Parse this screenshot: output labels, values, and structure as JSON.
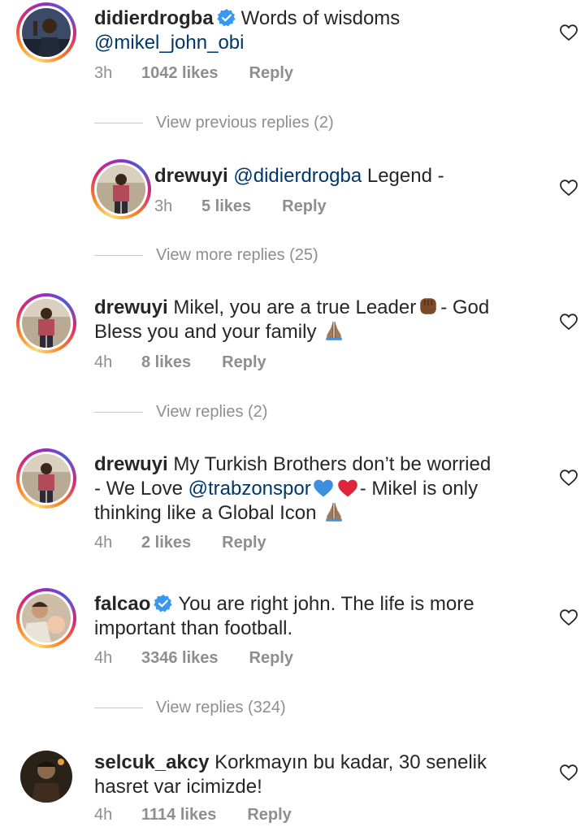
{
  "comments": [
    {
      "username": "didierdrogba",
      "text": "Words of wisdoms",
      "mention": "@mikel_john_obi",
      "time": "3h",
      "likes": "1042 likes",
      "reply": "Reply",
      "verified": true
    },
    {
      "username": "drewuyi",
      "mention": "@didierdrogba",
      "text": "Legend -",
      "time": "3h",
      "likes": "5 likes",
      "reply": "Reply"
    },
    {
      "username": "drewuyi",
      "text_line1": "Mikel, you are a true Leader",
      "text_line1_end": "- God",
      "text_line2": "Bless you and your family",
      "time": "4h",
      "likes": "8 likes",
      "reply": "Reply"
    },
    {
      "username": "drewuyi",
      "text_line1": "My Turkish Brothers don’t be worried",
      "text_line2_start": "- We Love",
      "mention": "@trabzonspor",
      "text_line2_end": "- Mikel is only",
      "text_line3": "thinking like a Global Icon",
      "time": "4h",
      "likes": "2 likes",
      "reply": "Reply"
    },
    {
      "username": "falcao",
      "text_line1": "You are right john. The life is more",
      "text_line2": "important than football.",
      "time": "4h",
      "likes": "3346 likes",
      "reply": "Reply",
      "verified": true
    },
    {
      "username": "selcuk_akcy",
      "text_line1": "Korkmayın bu kadar, 30 senelik",
      "text_line2": "hasret var icimizde!",
      "time": "4h",
      "likes": "1114 likes",
      "reply": "Reply"
    }
  ],
  "view_links": {
    "previous": "View previous replies (2)",
    "more": "View more replies (25)",
    "replies_a": "View replies (2)",
    "replies_b": "View replies (324)"
  },
  "icons": {
    "verified": "verified-badge-icon",
    "heart": "heart-outline-icon",
    "fist": "raised-fist-emoji",
    "pray": "folded-hands-emoji",
    "blue_heart": "blue-heart-emoji",
    "red_heart": "red-heart-emoji"
  },
  "colors": {
    "text": "#262626",
    "meta": "#8e8e8e",
    "mention": "#00376b",
    "verified": "#3897f0"
  }
}
